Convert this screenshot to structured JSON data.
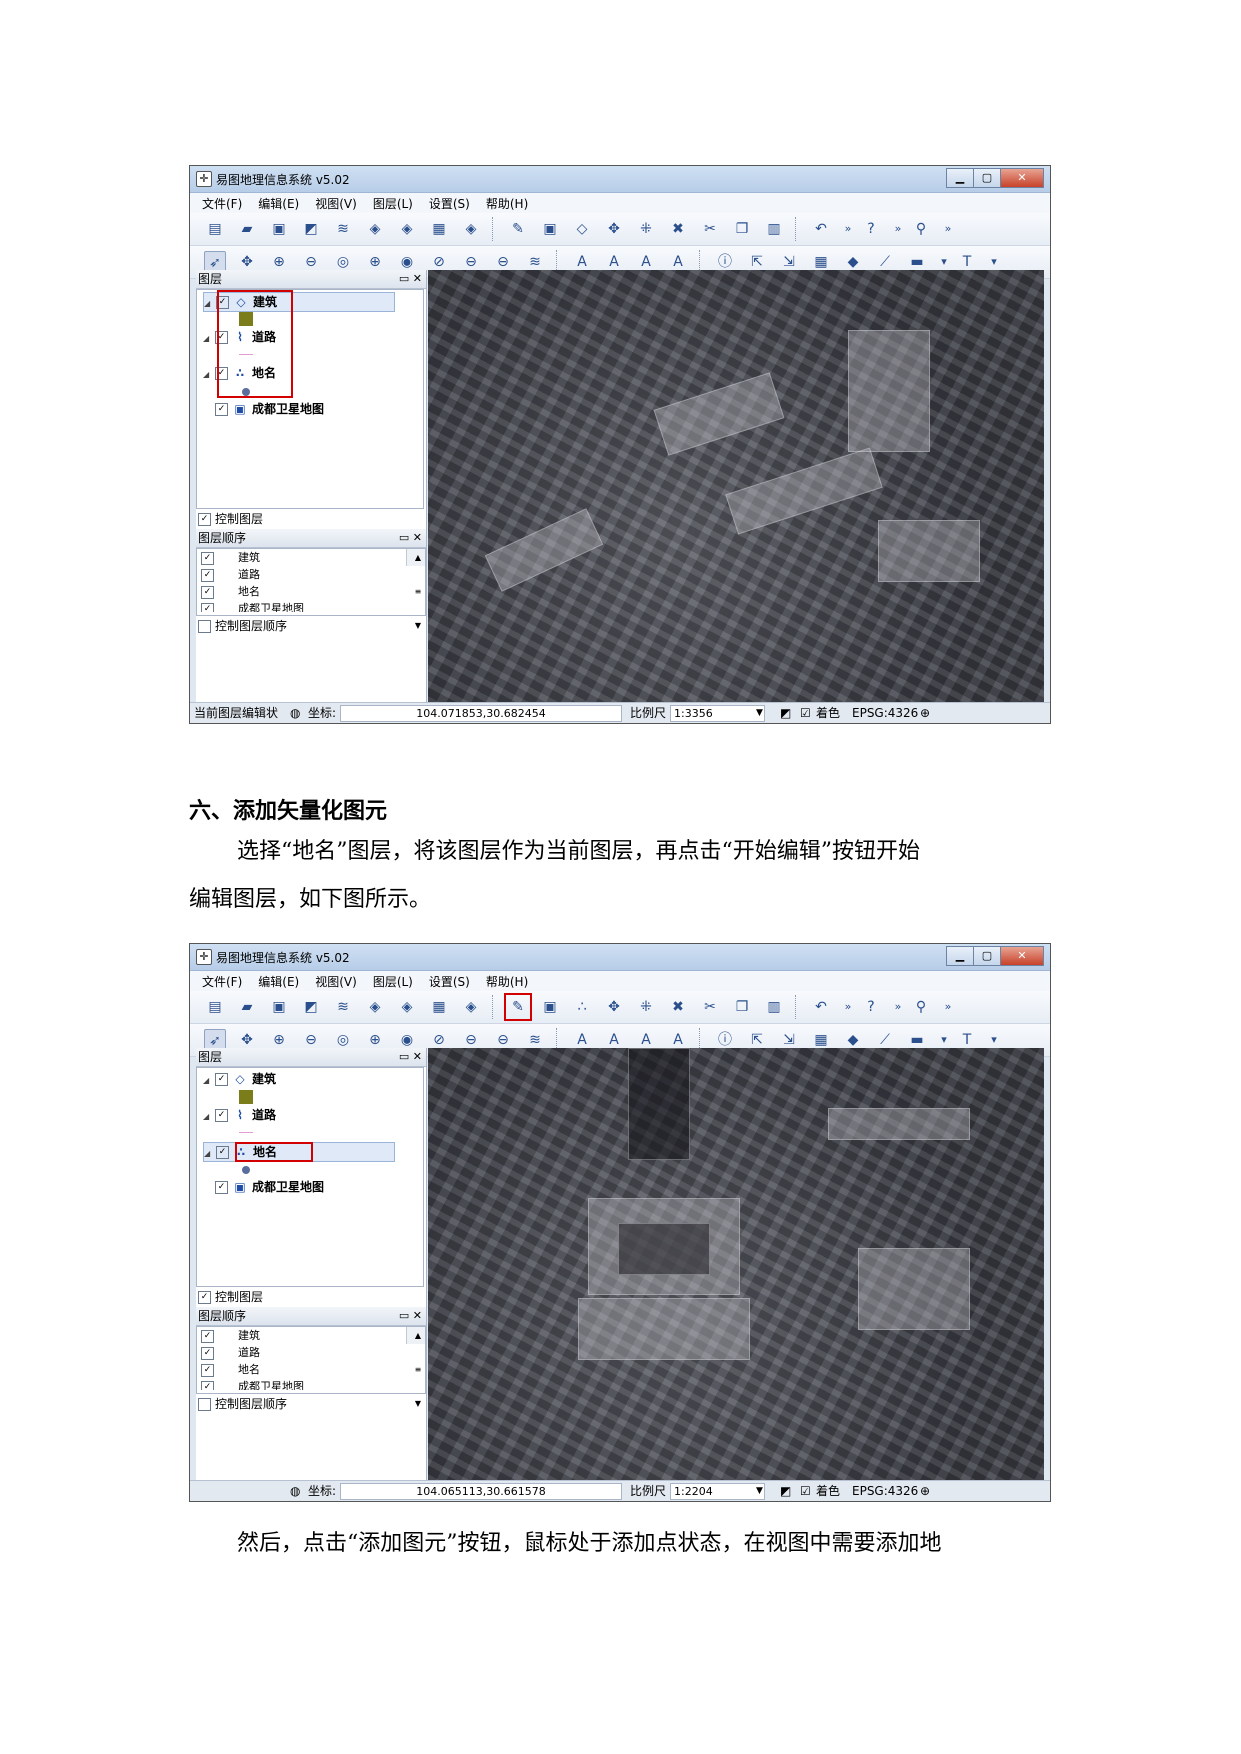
{
  "app": {
    "title": "易图地理信息系统 v5.02",
    "menus": [
      "文件(F)",
      "编辑(E)",
      "视图(V)",
      "图层(L)",
      "设置(S)",
      "帮助(H)"
    ],
    "layers_panel_title": "图层",
    "order_panel_title": "图层顺序",
    "control_layers": "控制图层",
    "control_layer_order": "控制图层顺序",
    "layers": [
      {
        "name": "建筑",
        "icon": "polygon-icon",
        "checked": true,
        "symbol_color": "#7a7d1a"
      },
      {
        "name": "道路",
        "icon": "line-icon",
        "checked": true,
        "symbol_color": "#e59ad0"
      },
      {
        "name": "地名",
        "icon": "point-icon",
        "checked": true,
        "symbol_color": "#5a6d9c"
      },
      {
        "name": "成都卫星地图",
        "icon": "raster-icon",
        "checked": true
      }
    ],
    "order_items": [
      "建筑",
      "道路",
      "地名",
      "成都卫星地图"
    ],
    "status": {
      "edit_state": "当前图层编辑状",
      "coord_label": "坐标:",
      "scale_label": "比例尺",
      "color_label": "着色",
      "epsg": "EPSG:4326"
    }
  },
  "screenshot1": {
    "coord": "104.071853,30.682454",
    "scale": "1:3356"
  },
  "screenshot2": {
    "coord": "104.065113,30.661578",
    "scale": "1:2204"
  },
  "doc": {
    "heading": "六、添加矢量化图元",
    "para1_line1": "选择“地名”图层，将该图层作为当前图层，再点击“开始编辑”按钮开始",
    "para1_line2": "编辑图层，如下图所示。",
    "para2": "然后，点击“添加图元”按钮，鼠标处于添加点状态，在视图中需要添加地"
  },
  "colors": {
    "highlight": "#d20000",
    "window_bg": "#dfe7f1"
  }
}
